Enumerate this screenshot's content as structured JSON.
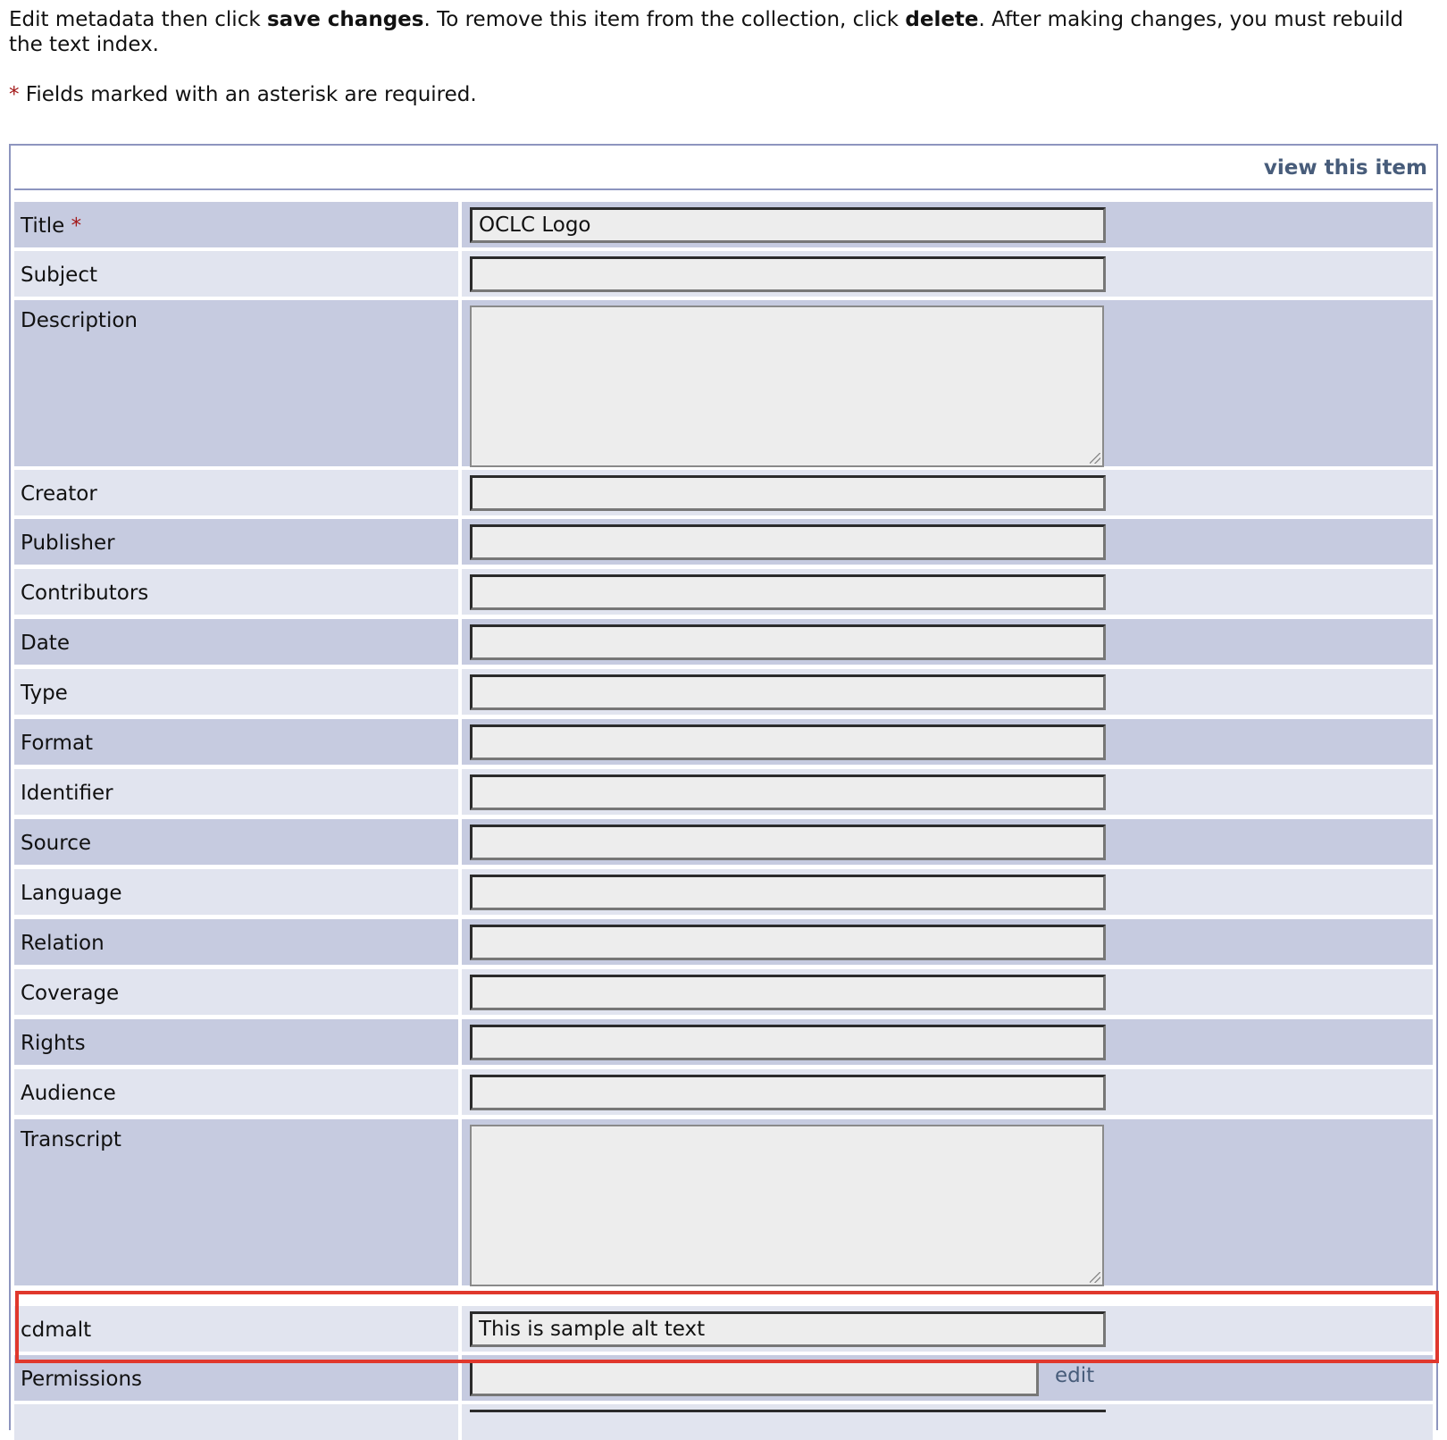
{
  "intro": {
    "part1": "Edit metadata then click ",
    "save_bold": "save changes",
    "part2": ". To remove this item from the collection, click ",
    "delete_bold": "delete",
    "part3": ". After making changes, you must rebuild the text index."
  },
  "required_note": {
    "asterisk": "*",
    "text": " Fields marked with an asterisk are required."
  },
  "panel": {
    "view_link": "view this item"
  },
  "fields": {
    "title": {
      "label": "Title",
      "required_mark": "*",
      "value": "OCLC Logo"
    },
    "subject": {
      "label": "Subject",
      "value": ""
    },
    "description": {
      "label": "Description",
      "value": ""
    },
    "creator": {
      "label": "Creator",
      "value": ""
    },
    "publisher": {
      "label": "Publisher",
      "value": ""
    },
    "contributors": {
      "label": "Contributors",
      "value": ""
    },
    "date": {
      "label": "Date",
      "value": ""
    },
    "type": {
      "label": "Type",
      "value": ""
    },
    "format": {
      "label": "Format",
      "value": ""
    },
    "identifier": {
      "label": "Identifier",
      "value": ""
    },
    "source": {
      "label": "Source",
      "value": ""
    },
    "language": {
      "label": "Language",
      "value": ""
    },
    "relation": {
      "label": "Relation",
      "value": ""
    },
    "coverage": {
      "label": "Coverage",
      "value": ""
    },
    "rights": {
      "label": "Rights",
      "value": ""
    },
    "audience": {
      "label": "Audience",
      "value": ""
    },
    "transcript": {
      "label": "Transcript",
      "value": ""
    },
    "cdmalt": {
      "label": "cdmalt",
      "value": "This is sample alt text"
    },
    "permissions": {
      "label": "Permissions",
      "value": "",
      "edit_link": "edit"
    }
  },
  "colors": {
    "row_dark": "#c6cbe0",
    "row_light": "#e1e4ef",
    "link": "#475c7a",
    "required": "#a31818",
    "highlight_box": "#e0382d"
  }
}
